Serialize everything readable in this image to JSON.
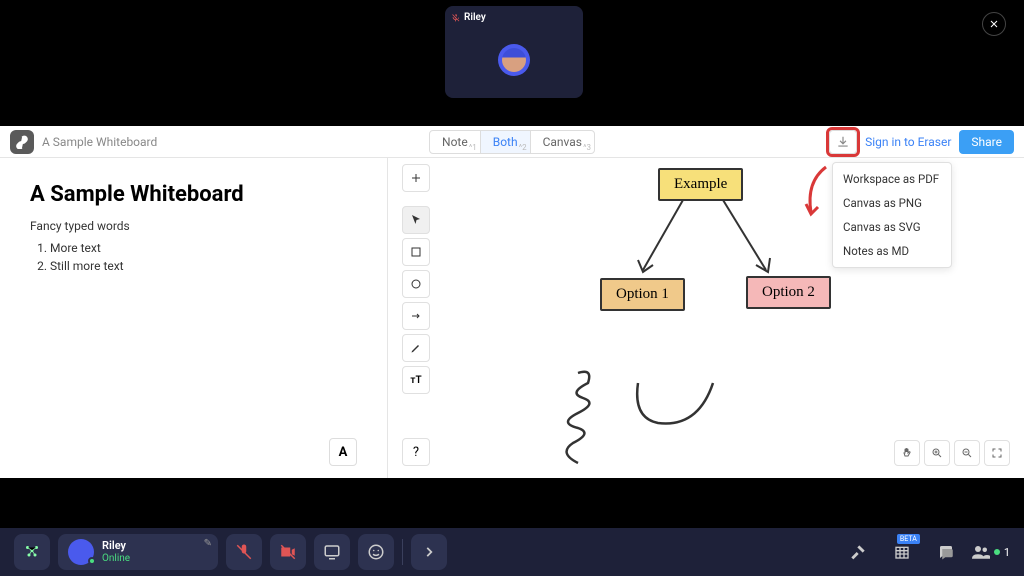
{
  "participant": {
    "name": "Riley",
    "muted": true
  },
  "app": {
    "title": "A Sample Whiteboard",
    "view_tabs": {
      "note": "Note",
      "both": "Both",
      "canvas": "Canvas"
    },
    "signin": "Sign in to Eraser",
    "share": "Share"
  },
  "export_menu": {
    "pdf": "Workspace as PDF",
    "png": "Canvas as PNG",
    "svg": "Canvas as SVG",
    "md": "Notes as MD"
  },
  "notes": {
    "title": "A Sample Whiteboard",
    "subtitle": "Fancy typed words",
    "items": {
      "0": "More text",
      "1": "Still more text"
    }
  },
  "canvas": {
    "example": "Example",
    "option1": "Option 1",
    "option2": "Option 2"
  },
  "meeting_bar": {
    "user_name": "Riley",
    "user_status": "Online",
    "beta": "BETA",
    "people_count": "1"
  }
}
